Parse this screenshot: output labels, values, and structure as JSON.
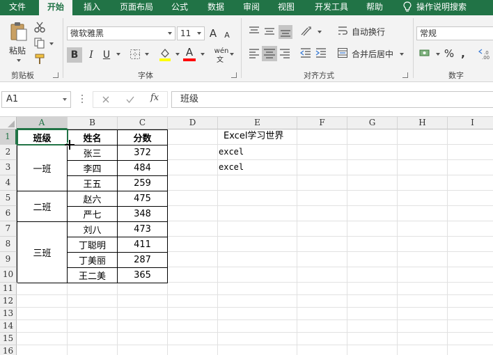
{
  "ribbon_tabs": [
    "文件",
    "开始",
    "插入",
    "页面布局",
    "公式",
    "数据",
    "审阅",
    "视图",
    "开发工具",
    "帮助"
  ],
  "active_tab": "开始",
  "tell_me": "操作说明搜索",
  "clipboard": {
    "paste_label": "粘贴",
    "group_label": "剪贴板"
  },
  "font": {
    "name": "微软雅黑",
    "size": "11",
    "group_label": "字体",
    "bold": "B",
    "italic": "I",
    "underline": "U",
    "grow": "A",
    "shrink": "A",
    "font_color_glyph": "A",
    "wen_glyph": "wén",
    "wen_sub": "文"
  },
  "alignment": {
    "wrap_label": "自动换行",
    "merge_label": "合并后居中",
    "group_label": "对齐方式"
  },
  "number": {
    "format": "常规",
    "group_label": "数字",
    "percent": "%"
  },
  "colors": {
    "accent": "#217346",
    "font_color_bar": "#ff0000",
    "fill_color_bar": "#ffff00"
  },
  "formula_bar": {
    "name_box": "A1",
    "formula": "班级",
    "fx": "fx"
  },
  "columns": [
    "A",
    "B",
    "C",
    "D",
    "E",
    "F",
    "G",
    "H",
    "I"
  ],
  "rows": [
    "1",
    "2",
    "3",
    "4",
    "5",
    "6",
    "7",
    "8",
    "9",
    "10",
    "11",
    "12",
    "13",
    "14",
    "15",
    "16"
  ],
  "table": {
    "headers": [
      "班级",
      "姓名",
      "分数"
    ],
    "classes": [
      "一班",
      "二班",
      "三班"
    ],
    "names": [
      "张三",
      "李四",
      "王五",
      "赵六",
      "严七",
      "刘八",
      "丁聪明",
      "丁美丽",
      "王二美"
    ],
    "scores": [
      "372",
      "484",
      "259",
      "475",
      "348",
      "473",
      "411",
      "287",
      "365"
    ]
  },
  "side_cells": {
    "e1": "Excel学习世界",
    "e2": "excel",
    "e3": "excel"
  }
}
